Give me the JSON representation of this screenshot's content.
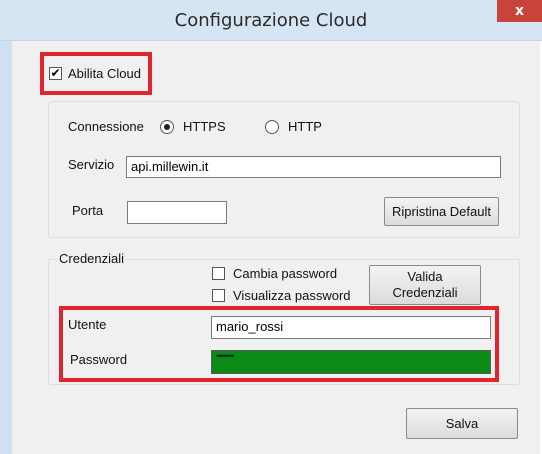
{
  "window": {
    "title": "Configurazione Cloud",
    "close_glyph": "x"
  },
  "enable_cloud": {
    "label": "Abilita Cloud",
    "checked": true
  },
  "connection": {
    "label": "Connessione",
    "options": [
      {
        "label": "HTTPS",
        "selected": true
      },
      {
        "label": "HTTP",
        "selected": false
      }
    ]
  },
  "service": {
    "label": "Servizio",
    "value": "api.millewin.it"
  },
  "port": {
    "label": "Porta",
    "value": ""
  },
  "reset_button": {
    "label": "Ripristina Default"
  },
  "credentials": {
    "group_label": "Credenziali",
    "change_password": {
      "label": "Cambia password",
      "checked": false
    },
    "show_password": {
      "label": "Visualizza password",
      "checked": false
    },
    "validate_button": {
      "line1": "Valida",
      "line2": "Credenziali"
    },
    "user": {
      "label": "Utente",
      "value": "mario_rossi"
    },
    "password": {
      "label": "Password",
      "masked": "••••••••",
      "field_color": "#0b8a16"
    }
  },
  "save_button": {
    "label": "Salva"
  },
  "colors": {
    "highlight": "#e1252f",
    "titlebar": "#d6e5f4",
    "close": "#c8443a"
  }
}
